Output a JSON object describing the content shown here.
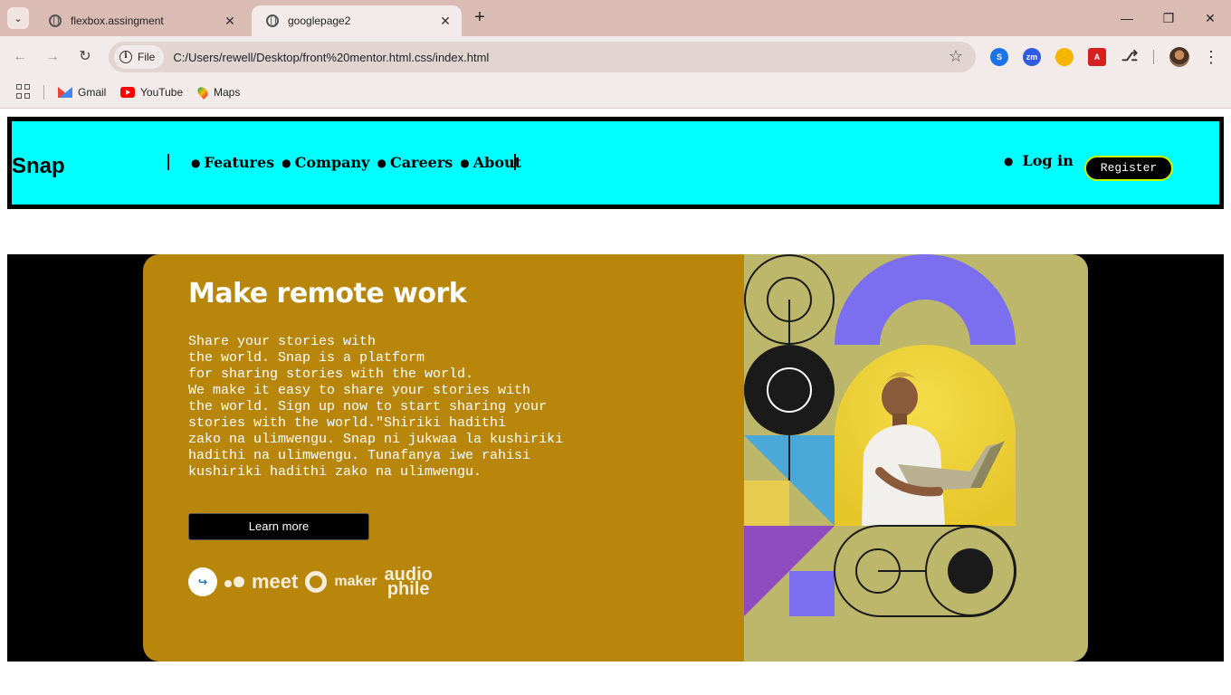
{
  "browser": {
    "tabs": [
      {
        "title": "flexbox.assingment",
        "active": false
      },
      {
        "title": "googlepage2",
        "active": true
      }
    ],
    "address": {
      "chip_label": "File",
      "url": "C:/Users/rewell/Desktop/front%20mentor.html.css/index.html"
    },
    "bookmarks": [
      {
        "label": "Gmail",
        "icon": "gmail-icon"
      },
      {
        "label": "YouTube",
        "icon": "youtube-icon"
      },
      {
        "label": "Maps",
        "icon": "maps-icon"
      }
    ],
    "extensions": [
      "shazam-icon",
      "zoom-icon",
      "orange-extension-icon",
      "pdf-icon",
      "puzzle-icon"
    ]
  },
  "site": {
    "logo": "Snap",
    "nav": [
      "Features",
      "Company",
      "Careers",
      "About"
    ],
    "login": "Log in",
    "register": "Register",
    "hero": {
      "title": "Make remote work",
      "body": "Share your stories with\nthe world. Snap is a platform\nfor sharing stories with the world.\nWe make it easy to share your stories with\nthe world. Sign up now to start sharing your\nstories with the world.\"Shiriki hadithi\nzako na ulimwengu. Snap ni jukwaa la kushiriki\nhadithi na ulimwengu. Tunafanya iwe rahisi\nkushiriki hadithi zako na ulimwengu.",
      "cta": "Learn more",
      "clients": [
        "meet",
        "maker",
        "audio",
        "phile"
      ]
    },
    "colors": {
      "navbar_bg": "#00ffff",
      "hero_left_bg": "#b8860b",
      "hero_right_bg": "#bdb76b",
      "arch": "#7b6ff0",
      "blue_block": "#4aa8d8",
      "yellow_block": "#e8cc50",
      "purple_block": "#8f4cc0"
    }
  }
}
